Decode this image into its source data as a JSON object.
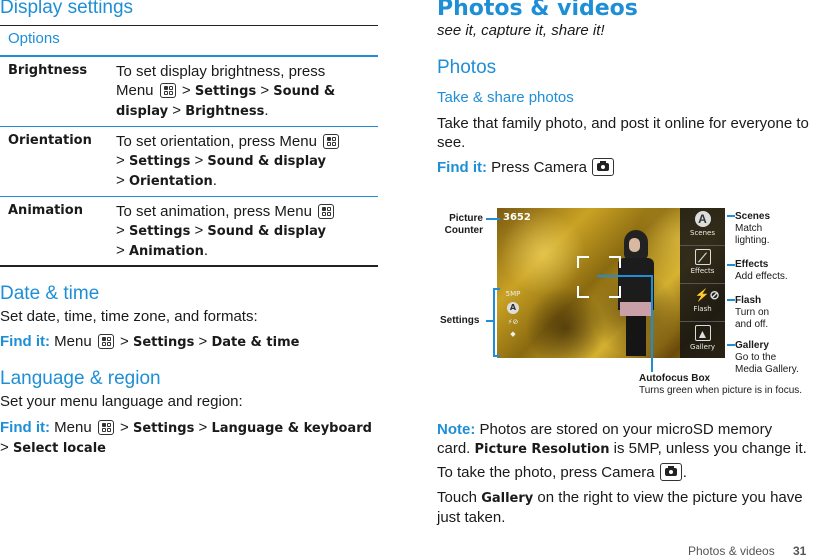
{
  "left": {
    "display_settings": {
      "title": "Display settings",
      "table_header": "Options",
      "rows": [
        {
          "label": "Brightness",
          "line1": "To set display brightness, press",
          "line2a": "Menu",
          "line2b": " > ",
          "line2c": "Settings",
          "line2d": " > ",
          "line2e": "Sound &",
          "line3a": "display",
          "line3b": " > ",
          "line3c": "Brightness",
          "line3d": "."
        },
        {
          "label": "Orientation",
          "line1": "To set orientation, press Menu",
          "line2a": "> ",
          "line2b": "Settings",
          "line2c": " > ",
          "line2d": "Sound & display",
          "line3a": "> ",
          "line3b": "Orientation",
          "line3c": "."
        },
        {
          "label": "Animation",
          "line1": "To set animation, press Menu",
          "line2a": "> ",
          "line2b": "Settings",
          "line2c": " > ",
          "line2d": "Sound & display",
          "line3a": "> ",
          "line3b": "Animation",
          "line3c": "."
        }
      ]
    },
    "date_time": {
      "title": "Date & time",
      "desc": "Set date, time, time zone, and formats:",
      "findit_label": "Find it:",
      "menu": " Menu ",
      "sep": " > ",
      "path1": "Settings",
      "path2": "Date & time"
    },
    "language": {
      "title": "Language & region",
      "desc": "Set your menu language and region:",
      "findit_label": "Find it:",
      "menu": " Menu ",
      "sep": " > ",
      "path1": "Settings",
      "path2": "Language & keyboard",
      "sep2": "> ",
      "path3": "Select locale"
    }
  },
  "right": {
    "title": "Photos & videos",
    "subtitle": "see it, capture it, share it!",
    "section": "Photos",
    "subsection": "Take & share photos",
    "intro": "Take that family photo, and post it online for everyone to see.",
    "findit_label": "Find it:",
    "findit_text": " Press Camera ",
    "camera": {
      "picture_counter": "3652",
      "resolution": "5MP",
      "sidebar": [
        "Scenes",
        "Effects",
        "Flash",
        "Gallery"
      ],
      "callouts": {
        "picture_counter": {
          "title": "Picture",
          "title2": "Counter"
        },
        "settings": {
          "title": "Settings"
        },
        "scenes": {
          "title": "Scenes",
          "desc1": "Match",
          "desc2": "lighting."
        },
        "effects": {
          "title": "Effects",
          "desc1": "Add effects."
        },
        "flash": {
          "title": "Flash",
          "desc1": "Turn on",
          "desc2": "and off."
        },
        "gallery": {
          "title": "Gallery",
          "desc1": "Go to the",
          "desc2": "Media Gallery."
        },
        "autofocus": {
          "title": "Autofocus Box",
          "desc1": "Turns green when picture is in focus."
        }
      }
    },
    "note_label": "Note:",
    "note_text1": " Photos are stored on your microSD memory",
    "note_text2a": "card. ",
    "note_bold": "Picture Resolution",
    "note_text2b": " is 5MP, unless you change it.",
    "take_photo": "To take the photo, press Camera ",
    "take_photo_end": ".",
    "touch_a": "Touch ",
    "touch_bold": "Gallery",
    "touch_b": " on the right to view the picture you have",
    "touch_c": "just taken."
  },
  "footer": {
    "section": "Photos & videos",
    "page": "31"
  },
  "colors": {
    "accent": "#1e8fd6",
    "text": "#1a1a1a"
  }
}
